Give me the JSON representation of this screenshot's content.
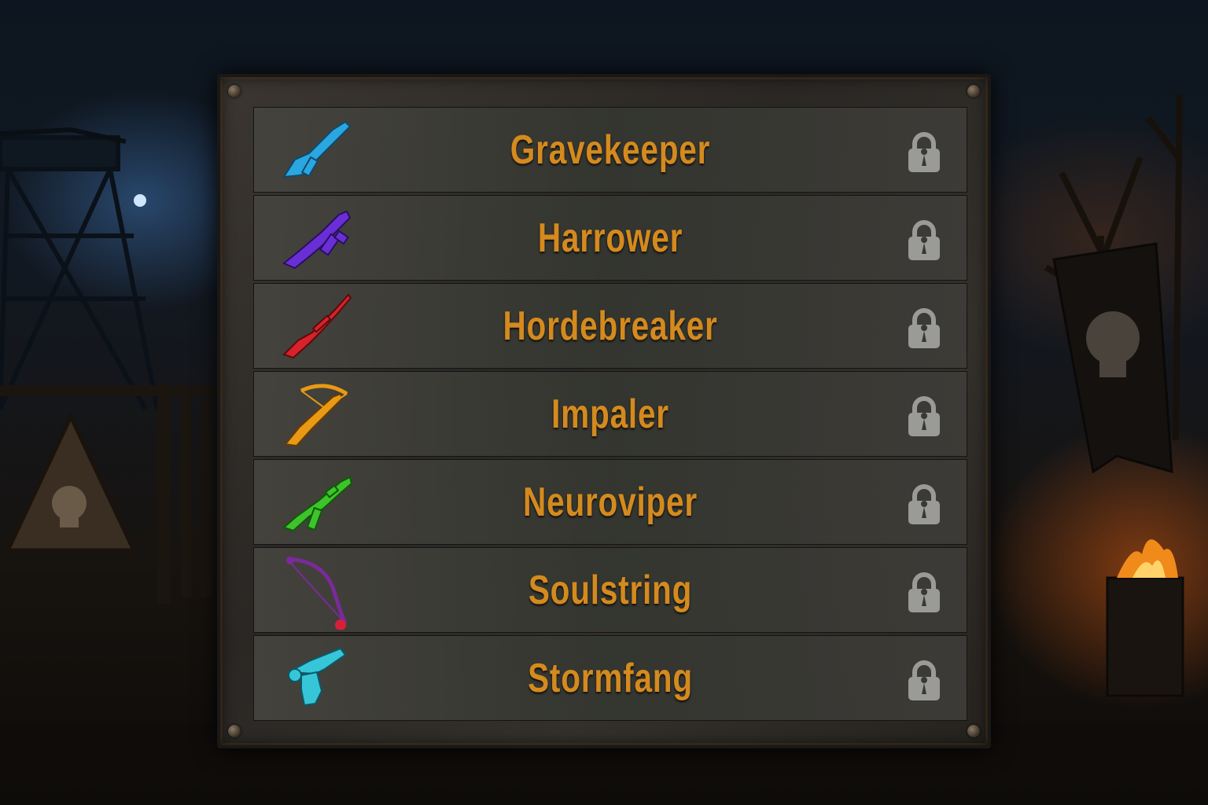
{
  "weapons": [
    {
      "name": "Gravekeeper",
      "icon": "assault-rifle-icon",
      "color": "#2aa6e0",
      "status": "locked"
    },
    {
      "name": "Harrower",
      "icon": "smg-icon",
      "color": "#6a2fd4",
      "status": "locked"
    },
    {
      "name": "Hordebreaker",
      "icon": "sniper-rifle-icon",
      "color": "#d8222a",
      "status": "locked"
    },
    {
      "name": "Impaler",
      "icon": "crossbow-icon",
      "color": "#e89a14",
      "status": "locked"
    },
    {
      "name": "Neuroviper",
      "icon": "submachine-gun-icon",
      "color": "#3ec42a",
      "status": "locked"
    },
    {
      "name": "Soulstring",
      "icon": "bow-icon",
      "color": "#7a2a9a",
      "status": "locked"
    },
    {
      "name": "Stormfang",
      "icon": "pistol-icon",
      "color": "#36c6d8",
      "status": "locked"
    }
  ],
  "colors": {
    "name_text": "#d48a1e",
    "lock": "#9a9a96",
    "frame": "#2a2724"
  }
}
